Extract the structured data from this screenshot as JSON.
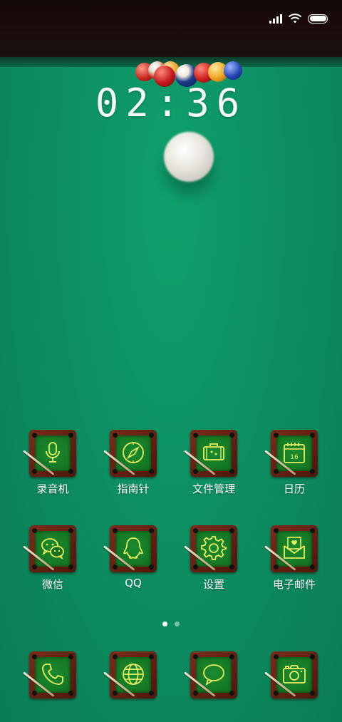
{
  "status_bar": {
    "signal_icon": "cellular-signal-icon",
    "wifi_icon": "wifi-icon",
    "battery_icon": "battery-icon",
    "battery_level": 1.0
  },
  "lockscreen": {
    "time": "02:36"
  },
  "apps_row1": [
    {
      "label": "录音机",
      "icon": "microphone-icon"
    },
    {
      "label": "指南针",
      "icon": "compass-icon"
    },
    {
      "label": "文件管理",
      "icon": "briefcase-icon"
    },
    {
      "label": "日历",
      "icon": "calendar-icon",
      "badge": "16"
    }
  ],
  "apps_row2": [
    {
      "label": "微信",
      "icon": "wechat-icon"
    },
    {
      "label": "QQ",
      "icon": "qq-penguin-icon"
    },
    {
      "label": "设置",
      "icon": "gear-icon"
    },
    {
      "label": "电子邮件",
      "icon": "mail-icon"
    }
  ],
  "dock": [
    {
      "icon": "phone-icon"
    },
    {
      "icon": "globe-icon"
    },
    {
      "icon": "message-bubble-icon"
    },
    {
      "icon": "camera-icon"
    }
  ],
  "pager": {
    "pages": 2,
    "current": 1
  },
  "colors": {
    "icon_line": "#e8f060",
    "felt": "#0d9163",
    "frame": "#6b2314"
  }
}
